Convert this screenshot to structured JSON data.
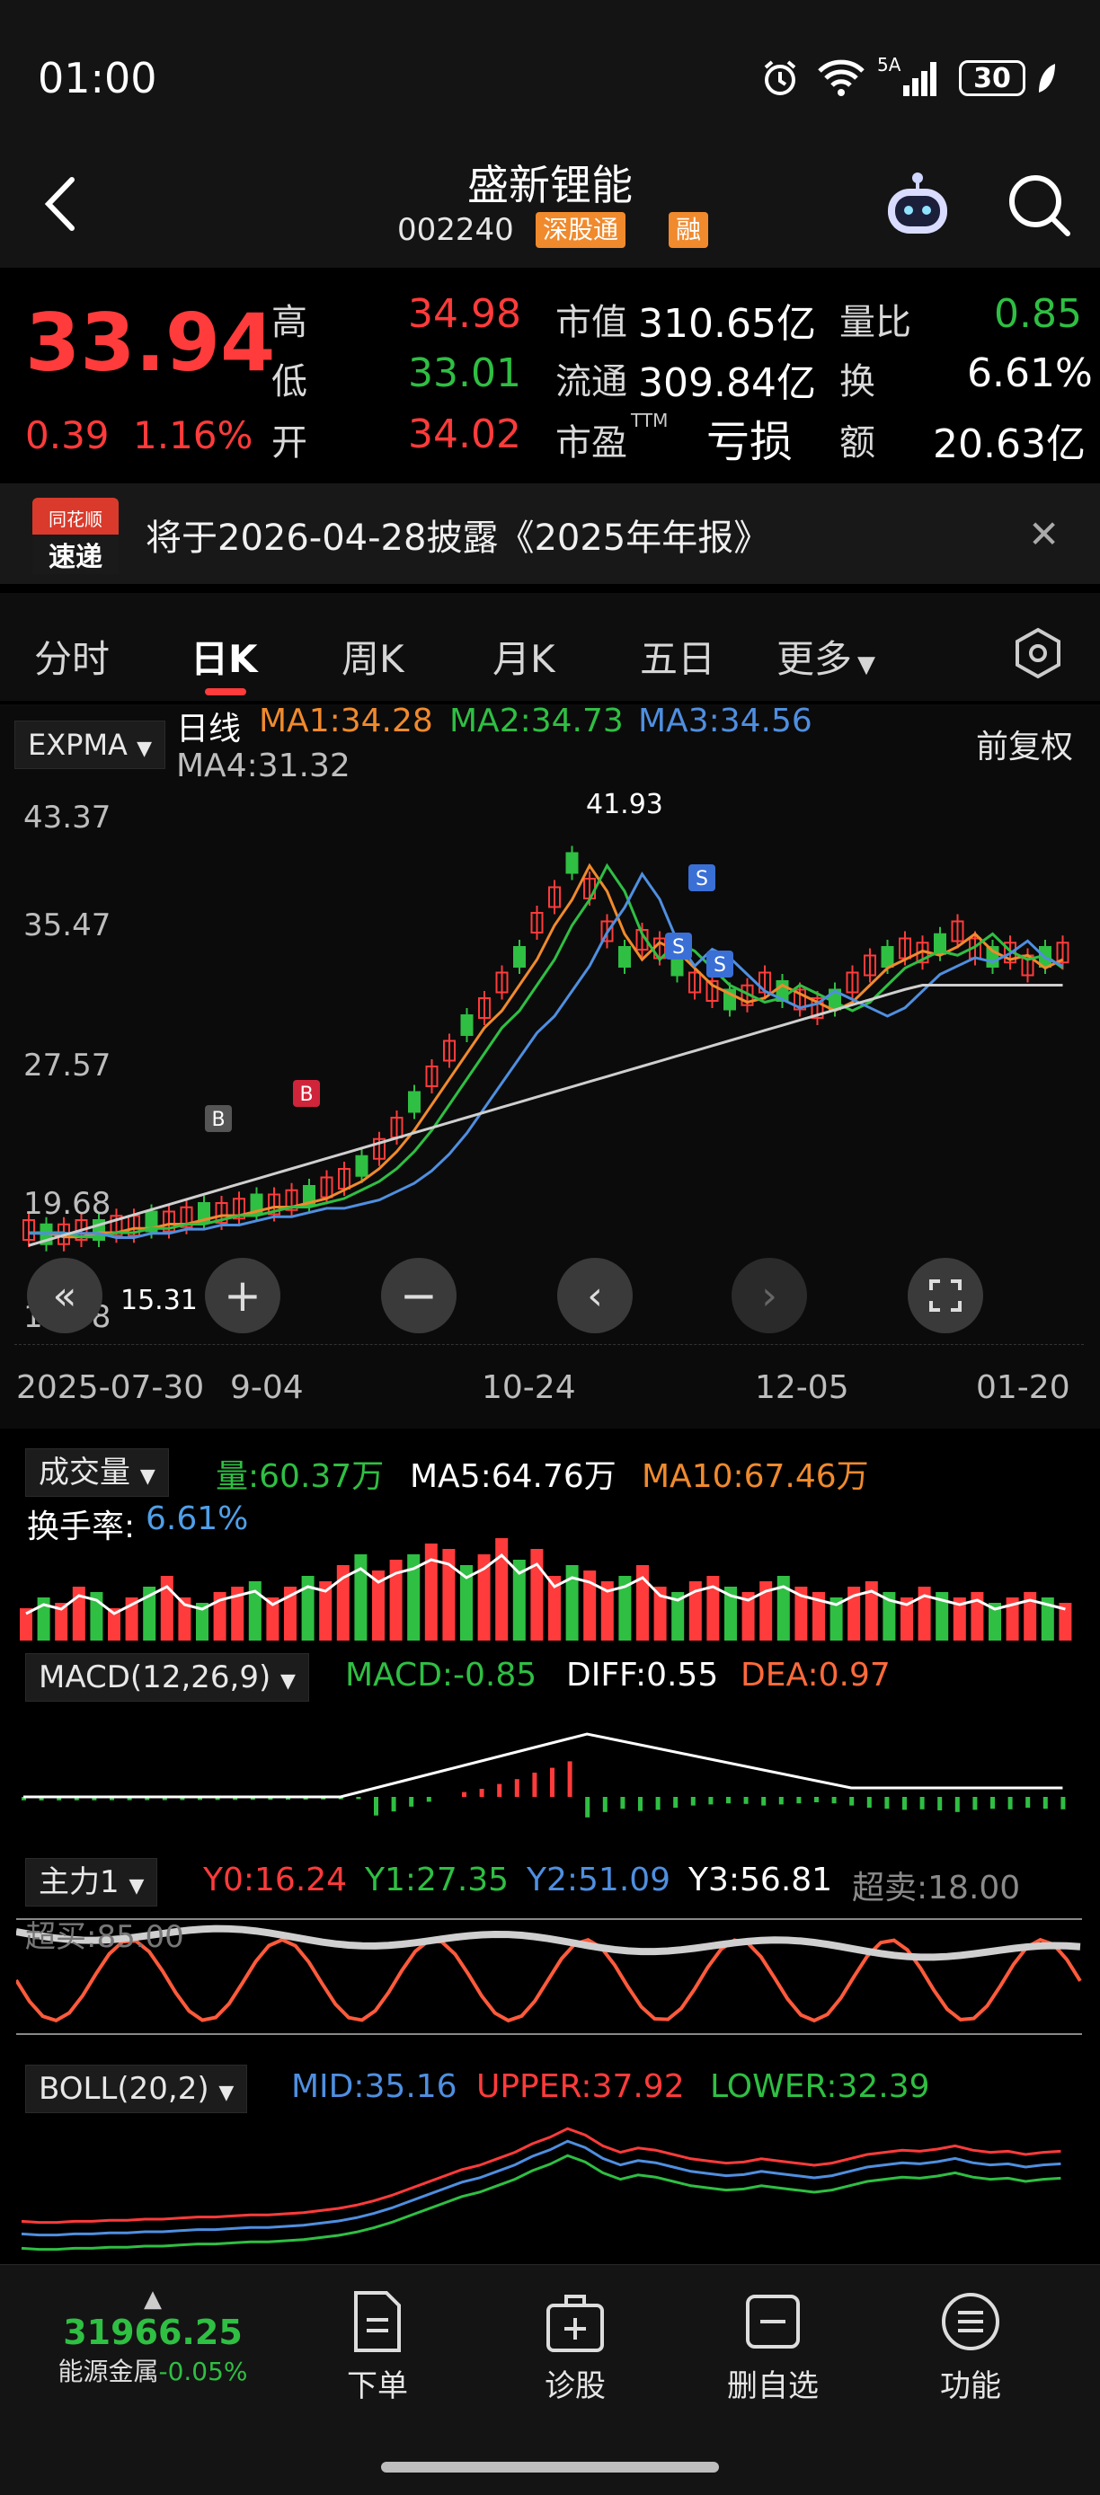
{
  "status_bar": {
    "time": "01:00",
    "signal": "5A",
    "battery": "30"
  },
  "header": {
    "title": "盛新锂能",
    "code": "002240",
    "tags": [
      "深股通",
      "融"
    ]
  },
  "quote": {
    "price": "33.94",
    "change": "0.39",
    "change_pct": "1.16%",
    "high_label": "高",
    "high": "34.98",
    "low_label": "低",
    "low": "33.01",
    "open_label": "开",
    "open": "34.02",
    "mktcap_label": "市值",
    "mktcap": "310.65亿",
    "float_label": "流通",
    "float": "309.84亿",
    "pe_label": "市盈",
    "pe_sup": "TTM",
    "pe": "亏损",
    "vol_ratio_label": "量比",
    "vol_ratio": "0.85",
    "turnover_label": "换",
    "turnover": "6.61%",
    "amount_label": "额",
    "amount": "20.63亿"
  },
  "news": {
    "logo_top": "同花顺",
    "logo_bottom": "速递",
    "text": "将于2026-04-28披露《2025年年报》"
  },
  "tabs": [
    "分时",
    "日K",
    "周K",
    "月K",
    "五日",
    "更多"
  ],
  "active_tab": "日K",
  "kline": {
    "indicator": "EXPMA",
    "line_label": "日线",
    "ma1": "MA1:34.28",
    "ma2": "MA2:34.73",
    "ma3": "MA3:34.56",
    "ma4": "MA4:31.32",
    "adjust": "前复权",
    "y_ticks": [
      "43.37",
      "35.47",
      "27.57",
      "19.68",
      "11.78"
    ],
    "x_ticks": [
      "2025-07-30",
      "9-04",
      "10-24",
      "12-05",
      "01-20"
    ],
    "max_label": "41.93",
    "min_label": "15.31",
    "markers": [
      "B",
      "B",
      "S",
      "S",
      "S"
    ]
  },
  "volume": {
    "selector": "成交量",
    "vol": "量:60.37万",
    "ma5": "MA5:64.76万",
    "ma10": "MA10:67.46万",
    "turnover_label": "换手率:",
    "turnover": "6.61%"
  },
  "macd": {
    "selector": "MACD(12,26,9)",
    "macd": "MACD:-0.85",
    "diff": "DIFF:0.55",
    "dea": "DEA:0.97"
  },
  "zhuli": {
    "selector": "主力1",
    "y0": "Y0:16.24",
    "y1": "Y1:27.35",
    "y2": "Y2:51.09",
    "y3": "Y3:56.81",
    "oversold": "超卖:18.00",
    "overbought": "超买:85.00"
  },
  "boll": {
    "selector": "BOLL(20,2)",
    "mid": "MID:35.16",
    "upper": "UPPER:37.92",
    "lower": "LOWER:32.39"
  },
  "bottom_bar": {
    "index_value": "31966.25",
    "index_name": "能源金属",
    "index_change": "-0.05%",
    "items": [
      "下单",
      "诊股",
      "删自选",
      "功能"
    ]
  },
  "colors": {
    "up": "#ff3b3b",
    "down": "#2fbf43",
    "accent": "#f08a2d",
    "blue": "#4f8fe0"
  }
}
